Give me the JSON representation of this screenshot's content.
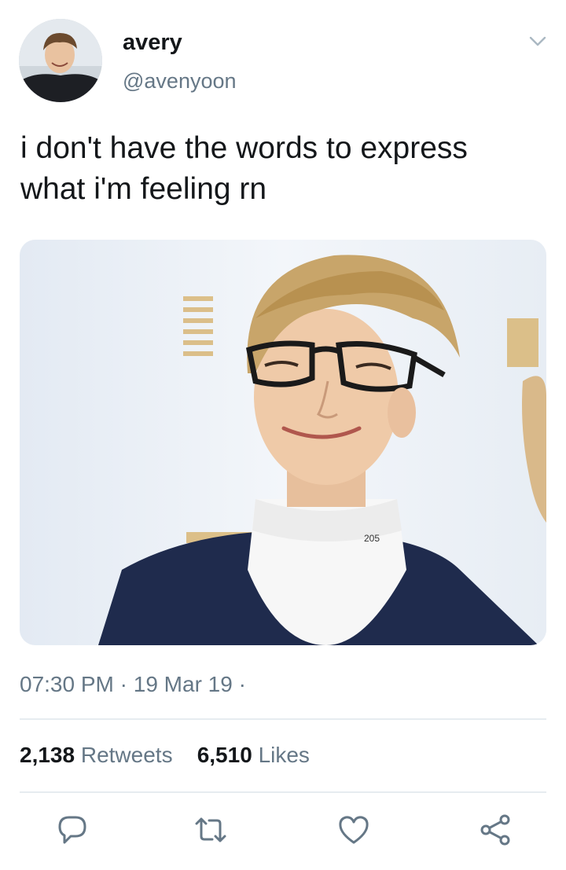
{
  "tweet": {
    "author": {
      "name": "avery",
      "handle": "@avenyoon"
    },
    "text_lines": [
      "i don't have the words to express",
      "what i'm feeling rn"
    ],
    "timestamp": "07:30 PM",
    "date": "19 Mar 19",
    "separator": "·",
    "retweets": {
      "count": "2,138",
      "label": "Retweets"
    },
    "likes": {
      "count": "6,510",
      "label": "Likes"
    },
    "photo": {
      "collar_text": "205"
    }
  },
  "icons": {
    "menu": "chevron-down-icon",
    "reply": "reply-icon",
    "retweet": "retweet-icon",
    "like": "heart-icon",
    "share": "share-icon"
  },
  "colors": {
    "text": "#14171a",
    "secondary": "#657786",
    "divider": "#e6ecf0",
    "chevron": "#aab8c2"
  }
}
